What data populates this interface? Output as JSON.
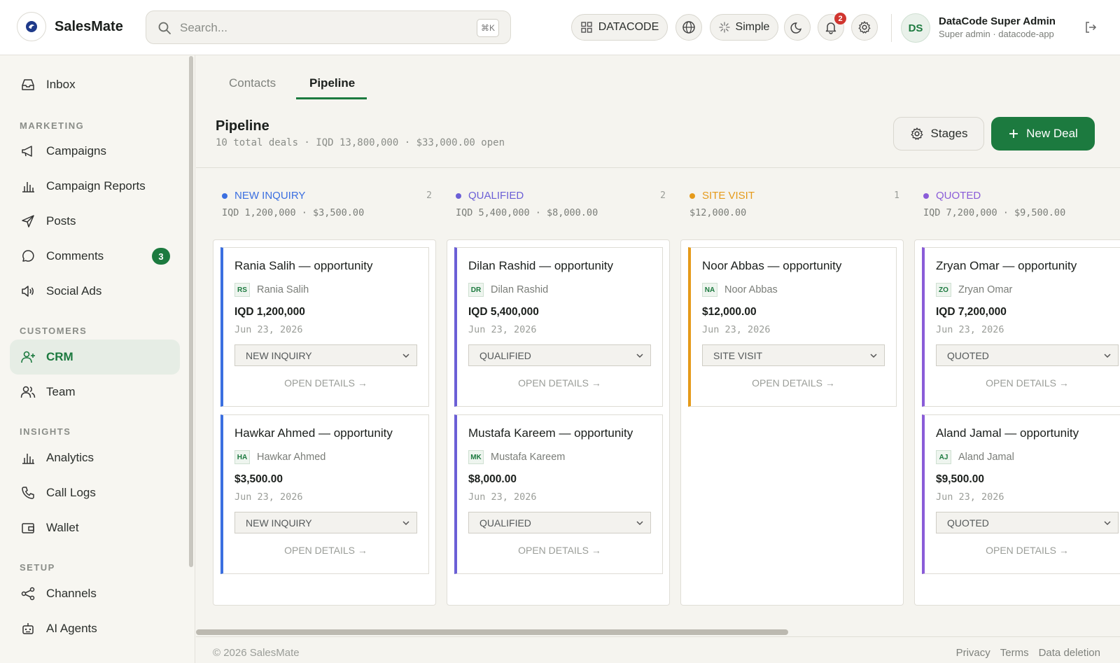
{
  "brand": {
    "name": "SalesMate"
  },
  "search": {
    "placeholder": "Search...",
    "shortcut": "⌘K"
  },
  "header": {
    "workspace_label": "DATACODE",
    "mode_label": "Simple",
    "notification_count": "2",
    "user": {
      "initials": "DS",
      "name": "DataCode Super Admin",
      "subtitle": "Super admin · datacode-app"
    }
  },
  "sidebar": {
    "top_items": [
      {
        "label": "Inbox",
        "icon": "inbox-icon"
      }
    ],
    "sections": [
      {
        "title": "MARKETING",
        "items": [
          {
            "label": "Campaigns",
            "icon": "megaphone-icon"
          },
          {
            "label": "Campaign Reports",
            "icon": "bar-chart-icon"
          },
          {
            "label": "Posts",
            "icon": "send-icon"
          },
          {
            "label": "Comments",
            "icon": "comment-icon",
            "badge": "3"
          },
          {
            "label": "Social Ads",
            "icon": "speaker-icon"
          }
        ]
      },
      {
        "title": "CUSTOMERS",
        "items": [
          {
            "label": "CRM",
            "icon": "user-plus-icon",
            "active": true
          },
          {
            "label": "Team",
            "icon": "users-icon"
          }
        ]
      },
      {
        "title": "INSIGHTS",
        "items": [
          {
            "label": "Analytics",
            "icon": "bar-chart-icon"
          },
          {
            "label": "Call Logs",
            "icon": "phone-icon"
          },
          {
            "label": "Wallet",
            "icon": "wallet-icon"
          }
        ]
      },
      {
        "title": "SETUP",
        "items": [
          {
            "label": "Channels",
            "icon": "share-icon"
          },
          {
            "label": "AI Agents",
            "icon": "robot-icon"
          }
        ]
      }
    ]
  },
  "tabs": [
    {
      "label": "Contacts"
    },
    {
      "label": "Pipeline",
      "active": true
    }
  ],
  "page": {
    "title": "Pipeline",
    "subtitle": "10 total deals · IQD 13,800,000 · $33,000.00 open",
    "stages_button": "Stages",
    "new_deal_button": "New Deal"
  },
  "colors": {
    "accent": "#1c7a3f",
    "new_inquiry": "#3b6fe0",
    "qualified": "#6b5fd6",
    "site_visit": "#e59a1a",
    "quoted": "#8a5cd8"
  },
  "columns": [
    {
      "name": "NEW INQUIRY",
      "count": "2",
      "total": "IQD 1,200,000 · $3,500.00",
      "color": "#3b6fe0",
      "cards": [
        {
          "title": "Rania Salih — opportunity",
          "initials": "RS",
          "contact": "Rania Salih",
          "amount": "IQD 1,200,000",
          "date": "Jun 23, 2026",
          "stage": "NEW INQUIRY",
          "details": "OPEN DETAILS →"
        },
        {
          "title": "Hawkar Ahmed — opportunity",
          "initials": "HA",
          "contact": "Hawkar Ahmed",
          "amount": "$3,500.00",
          "date": "Jun 23, 2026",
          "stage": "NEW INQUIRY",
          "details": "OPEN DETAILS →"
        }
      ]
    },
    {
      "name": "QUALIFIED",
      "count": "2",
      "total": "IQD 5,400,000 · $8,000.00",
      "color": "#6b5fd6",
      "cards": [
        {
          "title": "Dilan Rashid — opportunity",
          "initials": "DR",
          "contact": "Dilan Rashid",
          "amount": "IQD 5,400,000",
          "date": "Jun 23, 2026",
          "stage": "QUALIFIED",
          "details": "OPEN DETAILS →"
        },
        {
          "title": "Mustafa Kareem — opportunity",
          "initials": "MK",
          "contact": "Mustafa Kareem",
          "amount": "$8,000.00",
          "date": "Jun 23, 2026",
          "stage": "QUALIFIED",
          "details": "OPEN DETAILS →"
        }
      ]
    },
    {
      "name": "SITE VISIT",
      "count": "1",
      "total": "$12,000.00",
      "color": "#e59a1a",
      "cards": [
        {
          "title": "Noor Abbas — opportunity",
          "initials": "NA",
          "contact": "Noor Abbas",
          "amount": "$12,000.00",
          "date": "Jun 23, 2026",
          "stage": "SITE VISIT",
          "details": "OPEN DETAILS →"
        }
      ]
    },
    {
      "name": "QUOTED",
      "count": "",
      "total": "IQD 7,200,000 · $9,500.00",
      "color": "#8a5cd8",
      "cards": [
        {
          "title": "Zryan Omar — opportunity",
          "initials": "ZO",
          "contact": "Zryan Omar",
          "amount": "IQD 7,200,000",
          "date": "Jun 23, 2026",
          "stage": "QUOTED",
          "details": "OPEN DETAILS →"
        },
        {
          "title": "Aland Jamal — opportunity",
          "initials": "AJ",
          "contact": "Aland Jamal",
          "amount": "$9,500.00",
          "date": "Jun 23, 2026",
          "stage": "QUOTED",
          "details": "OPEN DETAILS →"
        }
      ]
    }
  ],
  "footer": {
    "copyright": "© 2026 SalesMate",
    "links": [
      "Privacy",
      "Terms",
      "Data deletion"
    ]
  }
}
